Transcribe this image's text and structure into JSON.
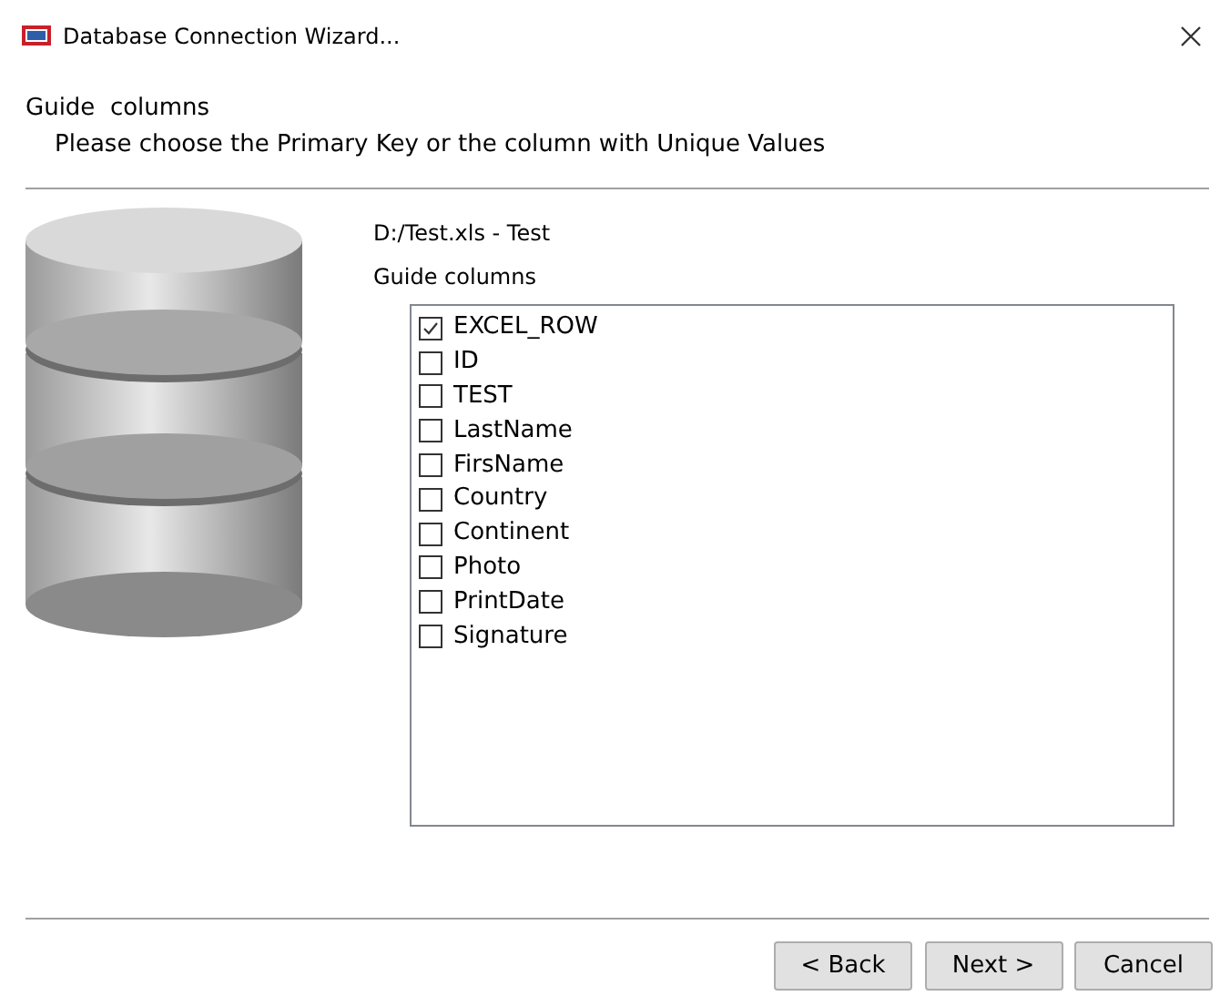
{
  "window": {
    "title": "Database Connection Wizard..."
  },
  "header": {
    "title": "Guide  columns",
    "subtitle": "Please choose the Primary Key or the column with Unique Values"
  },
  "source": "D:/Test.xls - Test",
  "list_label": "Guide columns",
  "columns": [
    {
      "label": "EXCEL_ROW",
      "checked": true
    },
    {
      "label": "ID",
      "checked": false
    },
    {
      "label": "TEST",
      "checked": false
    },
    {
      "label": "LastName",
      "checked": false
    },
    {
      "label": "FirsName",
      "checked": false
    },
    {
      "label": "Country",
      "checked": false
    },
    {
      "label": "Continent",
      "checked": false
    },
    {
      "label": "Photo",
      "checked": false
    },
    {
      "label": "PrintDate",
      "checked": false
    },
    {
      "label": "Signature",
      "checked": false
    }
  ],
  "buttons": [
    {
      "label": "< Back"
    },
    {
      "label": "Next >"
    },
    {
      "label": "Cancel"
    }
  ]
}
